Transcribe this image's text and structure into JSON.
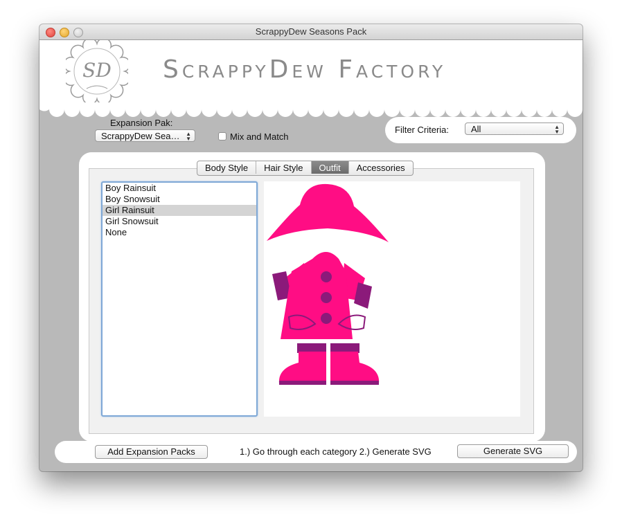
{
  "window": {
    "title": "ScrappyDew Seasons Pack"
  },
  "header": {
    "app_title": "ScrappyDew Factory",
    "logo_letters": "SD"
  },
  "expansion": {
    "label": "Expansion Pak:",
    "selected": "ScrappyDew Sea…",
    "mix_match_label": "Mix and Match",
    "mix_match_checked": false
  },
  "filter": {
    "label": "Filter Criteria:",
    "selected": "All"
  },
  "tabs": [
    {
      "label": "Body Style",
      "active": false
    },
    {
      "label": "Hair Style",
      "active": false
    },
    {
      "label": "Outfit",
      "active": true
    },
    {
      "label": "Accessories",
      "active": false
    }
  ],
  "outfit_list": {
    "items": [
      "Boy Rainsuit",
      "Boy Snowsuit",
      "Girl Rainsuit",
      "Girl Snowsuit",
      "None"
    ],
    "selected": "Girl Rainsuit"
  },
  "preview": {
    "outfit_color": "#ff0d84",
    "trim_color": "#8b1a7a"
  },
  "footer": {
    "add_button": "Add Expansion Packs",
    "instructions": "1.) Go through each category 2.)  Generate SVG",
    "generate_button": "Generate SVG"
  }
}
